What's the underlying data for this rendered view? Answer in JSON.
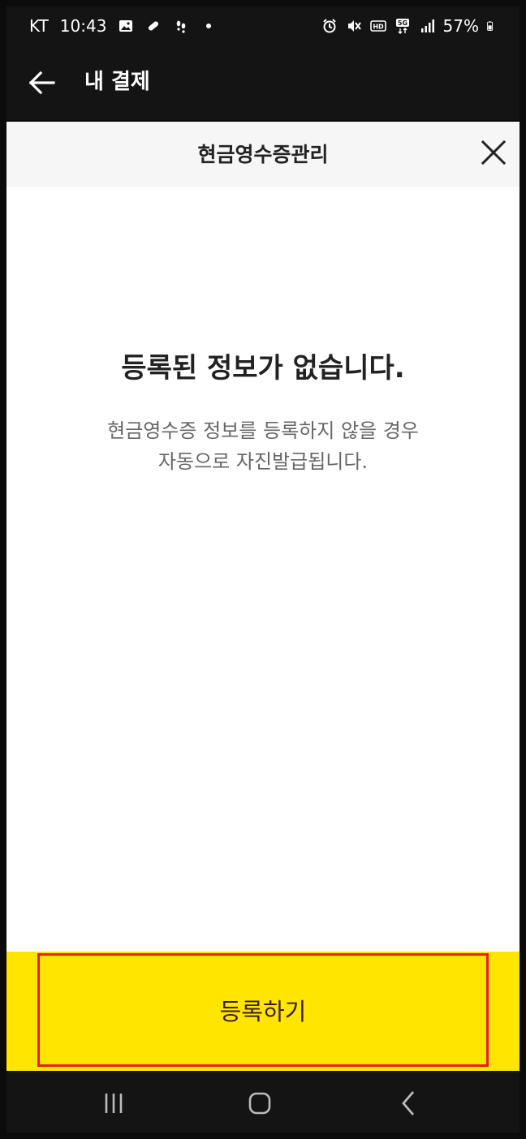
{
  "status_bar": {
    "carrier": "KT",
    "time": "10:43",
    "battery": "57%"
  },
  "header": {
    "title": "내 결제",
    "back_icon": "arrow-left-icon"
  },
  "sheet": {
    "title": "현금영수증관리",
    "close_icon": "close-icon",
    "empty_title": "등록된 정보가 없습니다.",
    "empty_desc_line1": "현금영수증 정보를 등록하지 않을 경우",
    "empty_desc_line2": "자동으로 자진발급됩니다."
  },
  "footer": {
    "register_label": "등록하기"
  },
  "colors": {
    "accent_yellow": "#ffe500",
    "highlight_red": "#e51e1e",
    "dark_bg": "#141414"
  }
}
